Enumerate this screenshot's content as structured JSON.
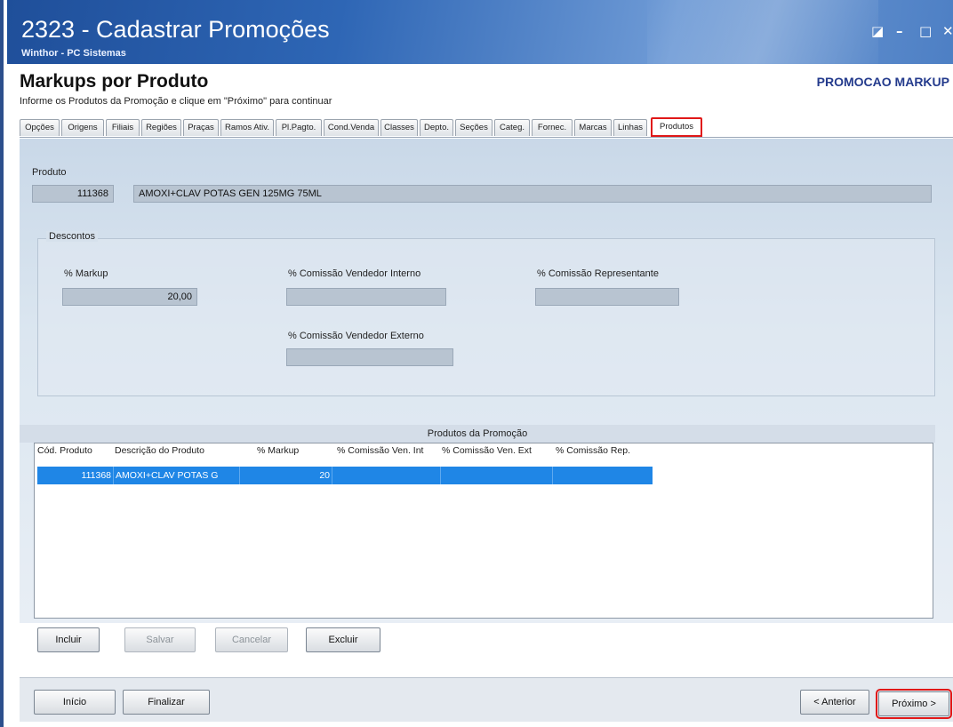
{
  "window": {
    "title": "2323 - Cadastrar Promoções",
    "subtitle": "Winthor - PC Sistemas",
    "controls": {
      "help": "◪",
      "minimize": "–",
      "maximize": "□",
      "close": "✕"
    }
  },
  "header": {
    "title": "Markups por Produto",
    "promo_name": "PROMOCAO MARKUP",
    "instruction": "Informe os Produtos da Promoção e clique em \"Próximo\" para continuar"
  },
  "tabs": [
    "Opções",
    "Origens",
    "Filiais",
    "Regiões",
    "Praças",
    "Ramos Ativ.",
    "Pl.Pagto.",
    "Cond.Venda",
    "Classes",
    "Depto.",
    "Seções",
    "Categ.",
    "Fornec.",
    "Marcas",
    "Linhas",
    "Produtos"
  ],
  "active_tab": "Produtos",
  "produto": {
    "label": "Produto",
    "codigo": "111368",
    "descricao": "AMOXI+CLAV POTAS GEN 125MG 75ML"
  },
  "descontos": {
    "label": "Descontos",
    "markup_label": "% Markup",
    "markup_value": "20,00",
    "com_vend_int_label": "% Comissão Vendedor Interno",
    "com_vend_int_value": "",
    "com_rep_label": "% Comissão Representante",
    "com_rep_value": "",
    "com_vend_ext_label": "% Comissão Vendedor Externo",
    "com_vend_ext_value": ""
  },
  "grid": {
    "title": "Produtos da Promoção",
    "columns": [
      "Cód. Produto",
      "Descrição do Produto",
      "% Markup",
      "% Comissão Ven. Int",
      "% Comissão Ven. Ext",
      "% Comissão Rep."
    ],
    "rows": [
      {
        "codigo": "111368",
        "descricao": "AMOXI+CLAV POTAS G",
        "markup": "20",
        "com_int": "",
        "com_ext": "",
        "com_rep": ""
      }
    ]
  },
  "actions": {
    "incluir": "Incluir",
    "salvar": "Salvar",
    "cancelar": "Cancelar",
    "excluir": "Excluir"
  },
  "nav": {
    "inicio": "Início",
    "finalizar": "Finalizar",
    "anterior": "< Anterior",
    "proximo": "Próximo >"
  },
  "colors": {
    "titlebar": "#2e66b5",
    "selection": "#1f86e6",
    "highlight": "#e01818",
    "promo": "#233a8c"
  }
}
